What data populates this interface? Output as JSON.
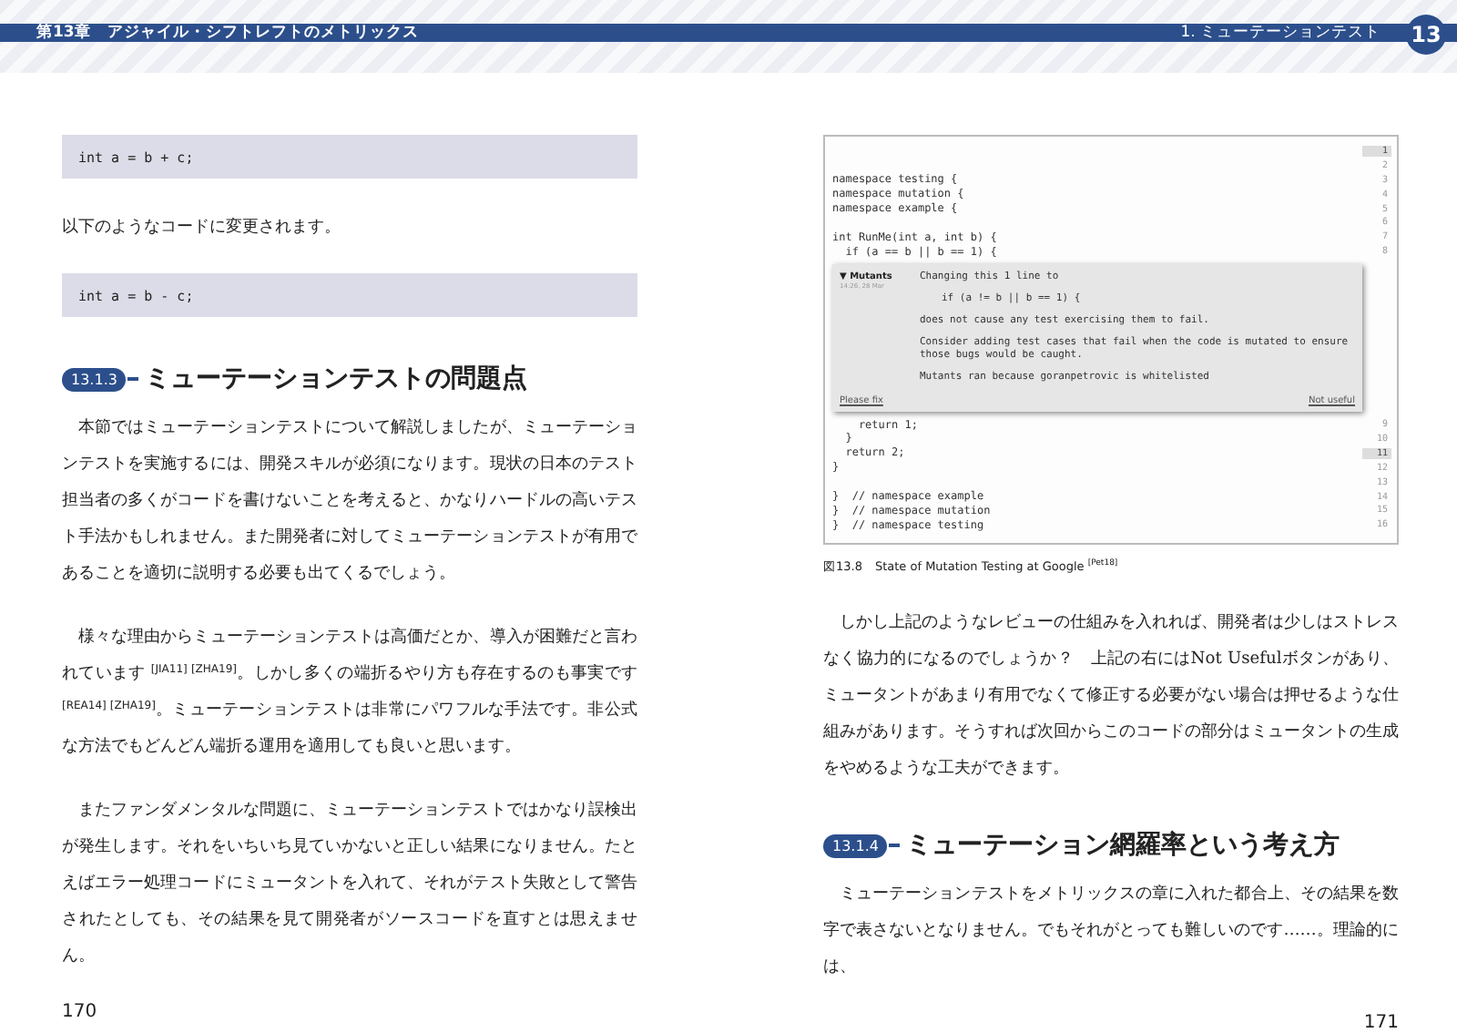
{
  "header": {
    "chapter": "第13章　アジャイル・シフトレフトのメトリックス",
    "section": "1. ミューテーションテスト",
    "chapter_number": "13"
  },
  "left_page": {
    "blocks": [
      {
        "kind": "code",
        "text": "int a = b + c;"
      },
      {
        "kind": "para",
        "text": "以下のようなコードに変更されます。"
      },
      {
        "kind": "code",
        "text": "int a = b - c;"
      },
      {
        "kind": "heading",
        "number": "13.1.3",
        "text": "ミューテーションテストの問題点"
      },
      {
        "kind": "para",
        "text": "　本節ではミューテーションテストについて解説しましたが、ミューテーションテストを実施するには、開発スキルが必須になります。現状の日本のテスト担当者の多くがコードを書けないことを考えると、かなりハードルの高いテスト手法かもしれません。また開発者に対してミューテーションテストが有用であることを適切に説明する必要も出てくるでしょう。"
      },
      {
        "kind": "para",
        "text": "　様々な理由からミューテーションテストは高価だとか、導入が困難だと言われています $^{[JIA11] [ZHA19]}$。しかし多くの端折るやり方も存在するのも事実です $^{[REA14] [ZHA19]}$。ミューテーションテストは非常にパワフルな手法です。非公式な方法でもどんどん端折る運用を適用しても良いと思います。"
      },
      {
        "kind": "para",
        "text": "　またファンダメンタルな問題に、ミューテーションテストではかなり誤検出が発生します。それをいちいち見ていかないと正しい結果になりません。たとえばエラー処理コードにミュータントを入れて、それがテスト失敗として警告されたとしても、その結果を見て開発者がソースコードを直すとは思えません。"
      }
    ],
    "page_number": "170"
  },
  "right_page": {
    "figure": {
      "code_top": [
        {
          "number": "1",
          "highlighted": true
        },
        {
          "number": "2",
          "highlighted": false
        },
        {
          "number": "3",
          "code": "namespace testing {",
          "highlighted": false
        },
        {
          "number": "4",
          "code": "namespace mutation {",
          "highlighted": false
        },
        {
          "number": "5",
          "code": "namespace example {",
          "highlighted": false
        },
        {
          "number": "6",
          "highlighted": false
        },
        {
          "number": "7",
          "code": "int RunMe(int a, int b) {",
          "highlighted": false
        },
        {
          "number": "8",
          "code": "  if (a == b || b == 1) {",
          "highlighted": false
        }
      ],
      "popup": {
        "title": "▼ Mutants",
        "timestamp": "14:26, 28 Mar",
        "lines": [
          {
            "kind": "text",
            "text": "Changing this 1 line to"
          },
          {
            "kind": "code",
            "text": "if (a != b || b == 1) {"
          },
          {
            "kind": "text",
            "text": "does not cause any test exercising them to fail."
          },
          {
            "kind": "text",
            "text": "Consider adding test cases that fail when the code is mutated to ensure those bugs would be caught."
          },
          {
            "kind": "text",
            "text": "Mutants ran because goranpetrovic is whitelisted"
          }
        ],
        "left_link": "Please fix",
        "right_link": "Not useful"
      },
      "code_bottom": [
        {
          "number": "9",
          "code": "    return 1;",
          "highlighted": false
        },
        {
          "number": "10",
          "code": "  }",
          "highlighted": false
        },
        {
          "number": "11",
          "code": "  return 2;",
          "highlighted": true
        },
        {
          "number": "12",
          "code": "}",
          "highlighted": false
        },
        {
          "number": "13",
          "highlighted": false
        },
        {
          "number": "14",
          "code": "}  // namespace example",
          "highlighted": false
        },
        {
          "number": "15",
          "code": "}  // namespace mutation",
          "highlighted": false
        },
        {
          "number": "16",
          "code": "}  // namespace testing",
          "highlighted": false
        }
      ],
      "caption": "図13.8　State of Mutation Testing at Google $^{[Pet18]}$"
    },
    "blocks": [
      {
        "kind": "para",
        "text": "　しかし上記のようなレビューの仕組みを入れれば、開発者は少しはストレスなく協力的になるのでしょうか？　上記の右にはNot Usefulボタンがあり、ミュータントがあまり有用でなくて修正する必要がない場合は押せるような仕組みがあります。そうすれば次回からこのコードの部分はミュータントの生成をやめるような工夫ができます。"
      },
      {
        "kind": "heading",
        "number": "13.1.4",
        "text": "ミューテーション網羅率という考え方"
      },
      {
        "kind": "para",
        "text": "　ミューテーションテストをメトリックスの章に入れた都合上、その結果を数字で表さないとなりません。でもそれがとっても難しいのです……。理論的には、"
      }
    ],
    "page_number": "171"
  }
}
